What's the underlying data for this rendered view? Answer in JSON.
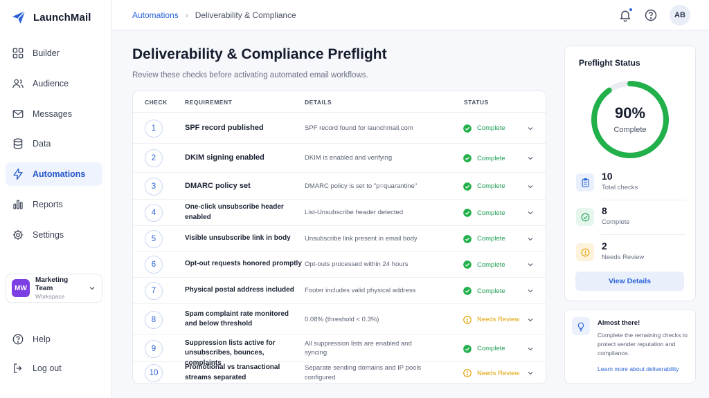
{
  "brand": {
    "name": "LaunchMail"
  },
  "colors": {
    "accent": "#2a63d8",
    "success": "#1f9d55",
    "warning": "#e0a100",
    "workspace": "#7b3fe4"
  },
  "sidebar": {
    "items": [
      {
        "label": "Builder",
        "icon": "grid-icon"
      },
      {
        "label": "Audience",
        "icon": "users-icon"
      },
      {
        "label": "Messages",
        "icon": "mail-icon"
      },
      {
        "label": "Data",
        "icon": "database-icon"
      },
      {
        "label": "Automations",
        "icon": "bolt-icon",
        "active": true
      },
      {
        "label": "Reports",
        "icon": "bar-chart-icon"
      },
      {
        "label": "Settings",
        "icon": "gear-icon"
      }
    ],
    "workspace": {
      "initials": "MW",
      "name": "Marketing Team",
      "sub": "Workspace"
    },
    "footer": [
      {
        "label": "Help",
        "icon": "help-icon"
      },
      {
        "label": "Log out",
        "icon": "logout-icon"
      }
    ]
  },
  "topbar": {
    "breadcrumb": {
      "parent": "Automations",
      "current": "Deliverability & Compliance"
    },
    "avatar": "AB"
  },
  "page": {
    "title": "Deliverability & Compliance Preflight",
    "subtitle": "Review these checks before activating automated email workflows."
  },
  "table": {
    "headers": {
      "check": "CHECK",
      "requirement": "REQUIREMENT",
      "details": "DETAILS",
      "status": "STATUS"
    },
    "rows": [
      {
        "num": "1",
        "requirement": "SPF record published",
        "details": "SPF record found for launchmail.com",
        "status": "Complete",
        "state": "ok"
      },
      {
        "num": "2",
        "requirement": "DKIM signing enabled",
        "details": "DKIM is enabled and verifying",
        "status": "Complete",
        "state": "ok"
      },
      {
        "num": "3",
        "requirement": "DMARC policy set",
        "details": "DMARC policy is set to \"p=quarantine\"",
        "status": "Complete",
        "state": "ok"
      },
      {
        "num": "4",
        "requirement": "One-click unsubscribe header enabled",
        "details": "List-Unsubscribe header detected",
        "status": "Complete",
        "state": "ok"
      },
      {
        "num": "5",
        "requirement": "Visible unsubscribe link in body",
        "details": "Unsubscribe link present in email body",
        "status": "Complete",
        "state": "ok"
      },
      {
        "num": "6",
        "requirement": "Opt-out requests honored promptly",
        "details": "Opt-outs processed within 24 hours",
        "status": "Complete",
        "state": "ok"
      },
      {
        "num": "7",
        "requirement": "Physical postal address included",
        "details": "Footer includes valid physical address",
        "status": "Complete",
        "state": "ok"
      },
      {
        "num": "8",
        "requirement": "Spam complaint rate monitored and below threshold",
        "details": "0.08% (threshold < 0.3%)",
        "status": "Needs Review",
        "state": "warn"
      },
      {
        "num": "9",
        "requirement": "Suppression lists active for unsubscribes, bounces, complaints",
        "details": "All suppression lists are enabled and syncing",
        "status": "Complete",
        "state": "ok"
      },
      {
        "num": "10",
        "requirement": "Promotional vs transactional streams separated",
        "details": "Separate sending domains and IP pools configured",
        "status": "Needs Review",
        "state": "warn"
      }
    ]
  },
  "preflight": {
    "title": "Preflight Status",
    "percent": "90%",
    "percent_value": 90,
    "percent_label": "Complete",
    "stats": [
      {
        "value": "10",
        "label": "Total checks",
        "icon": "clipboard-icon"
      },
      {
        "value": "8",
        "label": "Complete",
        "icon": "check-circle-icon"
      },
      {
        "value": "2",
        "label": "Needs Review",
        "icon": "alert-icon"
      }
    ],
    "button": "View Details"
  },
  "tip": {
    "title": "Almost there!",
    "body": "Complete the remaining checks to protect sender reputation and compliance.",
    "link": "Learn more about deliverability"
  }
}
